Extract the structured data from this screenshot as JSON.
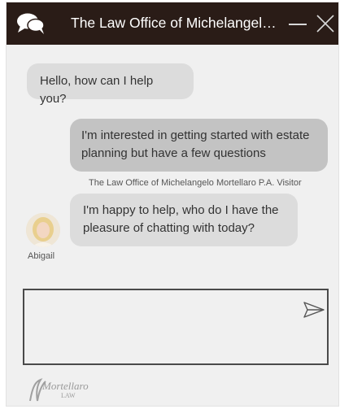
{
  "header": {
    "title": "The Law Office of Michelangelo Mortellaro P.A.",
    "chat_icon": "chat-bubbles-icon",
    "minimize_icon": "minimize-icon",
    "close_icon": "close-icon"
  },
  "messages": [
    {
      "sender": "bot",
      "text": "Hello, how can I help you?"
    },
    {
      "sender": "visitor",
      "text": "I'm interested in getting started with estate planning but have a few questions",
      "meta": "The Law Office of Michelangelo Mortellaro P.A. Visitor"
    },
    {
      "sender": "agent",
      "text": "I'm happy to help, who do I have the pleasure of chatting with today?",
      "agent_name": "Abigail"
    }
  ],
  "composer": {
    "value": "",
    "send_icon": "send-icon"
  },
  "footer": {
    "logo_text": "Mortellaro",
    "logo_sub": "LAW"
  },
  "colors": {
    "header_bg": "#2a1c17",
    "panel_bg": "#f0f0f0",
    "bot_bubble": "#dcdcdc",
    "visitor_bubble": "#c3c3c3"
  }
}
